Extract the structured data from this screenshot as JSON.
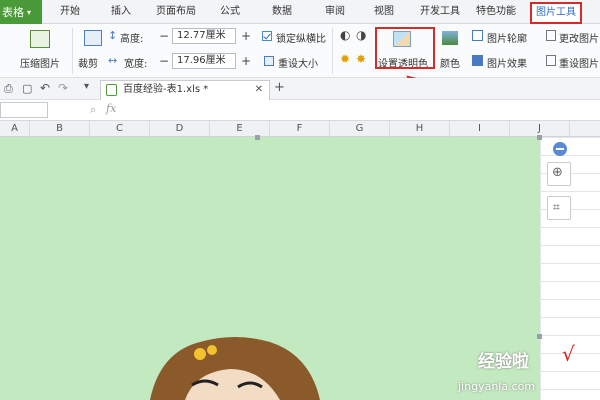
{
  "menubar": {
    "app_label": "表格",
    "items": [
      "开始",
      "插入",
      "页面布局",
      "公式",
      "数据",
      "审阅",
      "视图",
      "开发工具",
      "特色功能",
      "图片工具"
    ],
    "active_item": "图片工具"
  },
  "ribbon": {
    "compress_label": "压缩图片",
    "crop_label": "裁剪",
    "height_label": "高度:",
    "height_value": "12.77厘米",
    "width_label": "宽度:",
    "width_value": "17.96厘米",
    "lock_ratio_label": "锁定纵横比",
    "reset_size_label": "重设大小",
    "set_transparent_label": "设置透明色",
    "color_label": "颜色",
    "outline_label": "图片轮廓",
    "effects_label": "图片效果",
    "change_picture_label": "更改图片",
    "reset_picture_label": "重设图片"
  },
  "document_tab": {
    "title": "百度经验-表1.xls *"
  },
  "formula_bar": {
    "fx_label": "fx"
  },
  "columns": [
    "A",
    "B",
    "C",
    "D",
    "E",
    "F",
    "G",
    "H",
    "I",
    "J"
  ],
  "watermark": {
    "brand": "经验啦",
    "url": "jingyanla.com",
    "check": "√"
  },
  "colors": {
    "app_green": "#4a9a3a",
    "highlight_red": "#d62b2b",
    "picture_bg": "#c3e9c0"
  }
}
